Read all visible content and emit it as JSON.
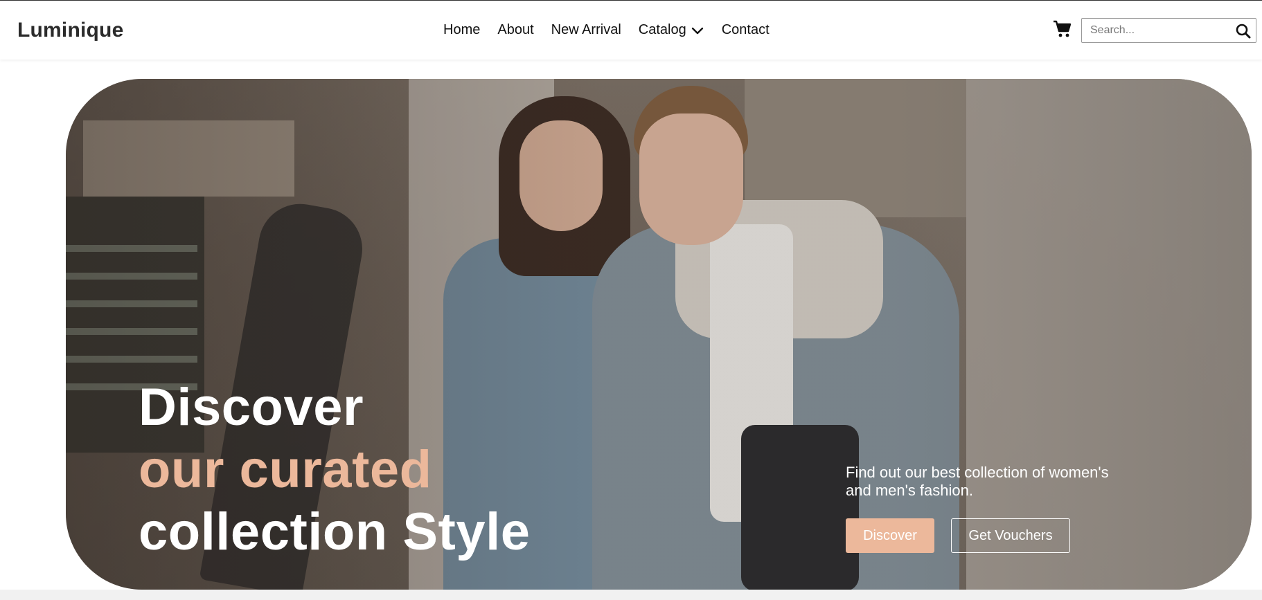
{
  "header": {
    "logo": "Luminique",
    "nav": [
      {
        "label": "Home"
      },
      {
        "label": "About"
      },
      {
        "label": "New Arrival"
      },
      {
        "label": "Catalog",
        "icon": "chevron-down-icon"
      },
      {
        "label": "Contact"
      }
    ],
    "cart_icon": "cart-icon",
    "search": {
      "placeholder": "Search...",
      "icon": "search-icon",
      "value": ""
    }
  },
  "hero": {
    "headline_line1": "Discover",
    "headline_line2": "our curated",
    "headline_line3": "collection Style",
    "description": "Find out our best collection of women's and men's fashion.",
    "discover_label": "Discover",
    "vouchers_label": "Get Vouchers"
  },
  "colors": {
    "accent": "#ecb89b",
    "text_dark": "#222222",
    "white": "#ffffff"
  }
}
